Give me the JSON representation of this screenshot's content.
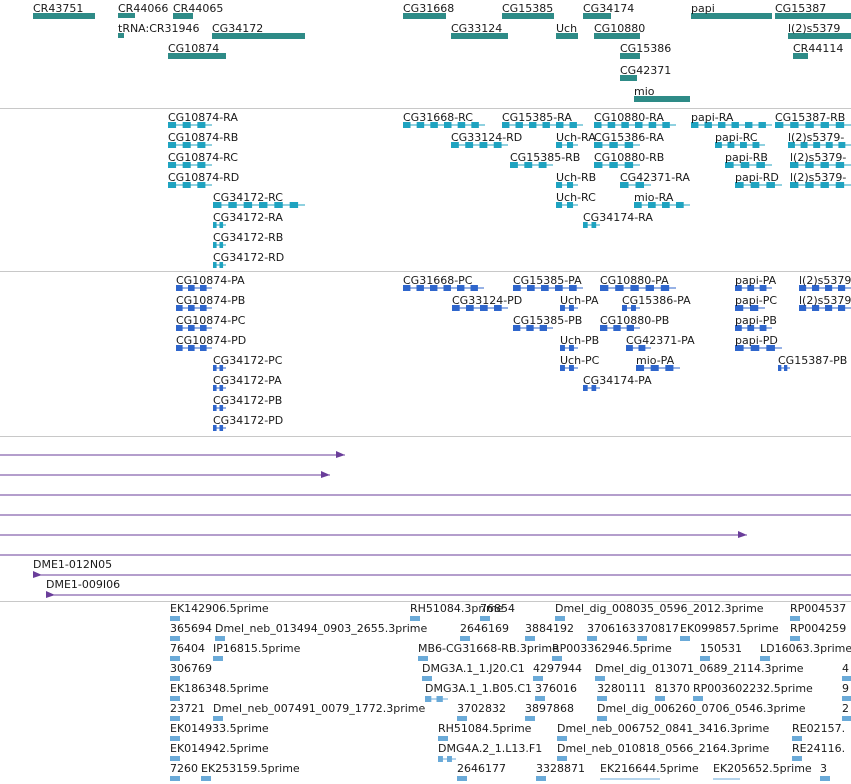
{
  "tracks": [
    {
      "name": "gene-track",
      "color": "#2e8b87",
      "features": [
        {
          "label": "CR43751"
        },
        {
          "label": "CR44066"
        },
        {
          "label": "CR44065"
        },
        {
          "label": "CG31668"
        },
        {
          "label": "CG15385"
        },
        {
          "label": "CG34174"
        },
        {
          "label": "papi"
        },
        {
          "label": "CG15387"
        },
        {
          "label": "tRNA:CR31946"
        },
        {
          "label": "CG34172"
        },
        {
          "label": "CG33124"
        },
        {
          "label": "Uch"
        },
        {
          "label": "CG10880"
        },
        {
          "label": "l(2)s5379"
        },
        {
          "label": "CG10874"
        },
        {
          "label": "CG15386"
        },
        {
          "label": "CR44114"
        },
        {
          "label": "CG42371"
        },
        {
          "label": "mio"
        }
      ]
    },
    {
      "name": "transcript-track",
      "color": "#1fa3c0",
      "features": [
        {
          "label": "CG10874-RA"
        },
        {
          "label": "CG10874-RB"
        },
        {
          "label": "CG10874-RC"
        },
        {
          "label": "CG10874-RD"
        },
        {
          "label": "CG34172-RC"
        },
        {
          "label": "CG34172-RA"
        },
        {
          "label": "CG34172-RB"
        },
        {
          "label": "CG34172-RD"
        },
        {
          "label": "CG31668-RC"
        },
        {
          "label": "CG33124-RD"
        },
        {
          "label": "CG15385-RA"
        },
        {
          "label": "Uch-RA"
        },
        {
          "label": "CG15385-RB"
        },
        {
          "label": "Uch-RB"
        },
        {
          "label": "Uch-RC"
        },
        {
          "label": "CG10880-RA"
        },
        {
          "label": "CG15386-RA"
        },
        {
          "label": "CG10880-RB"
        },
        {
          "label": "CG42371-RA"
        },
        {
          "label": "mio-RA"
        },
        {
          "label": "CG34174-RA"
        },
        {
          "label": "papi-RA"
        },
        {
          "label": "papi-RC"
        },
        {
          "label": "papi-RB"
        },
        {
          "label": "papi-RD"
        },
        {
          "label": "CG15387-RB"
        },
        {
          "label": "l(2)s5379-"
        },
        {
          "label": "l(2)s5379-"
        },
        {
          "label": "l(2)s5379-"
        }
      ]
    },
    {
      "name": "protein-track",
      "color": "#2f66cc",
      "features": [
        {
          "label": "CG10874-PA"
        },
        {
          "label": "CG10874-PB"
        },
        {
          "label": "CG10874-PC"
        },
        {
          "label": "CG10874-PD"
        },
        {
          "label": "CG34172-PC"
        },
        {
          "label": "CG34172-PA"
        },
        {
          "label": "CG34172-PB"
        },
        {
          "label": "CG34172-PD"
        },
        {
          "label": "CG31668-PC"
        },
        {
          "label": "CG33124-PD"
        },
        {
          "label": "CG15385-PA"
        },
        {
          "label": "Uch-PA"
        },
        {
          "label": "CG15385-PB"
        },
        {
          "label": "Uch-PB"
        },
        {
          "label": "Uch-PC"
        },
        {
          "label": "CG10880-PA"
        },
        {
          "label": "CG15386-PA"
        },
        {
          "label": "CG10880-PB"
        },
        {
          "label": "CG42371-PA"
        },
        {
          "label": "mio-PA"
        },
        {
          "label": "CG34174-PA"
        },
        {
          "label": "papi-PA"
        },
        {
          "label": "papi-PC"
        },
        {
          "label": "papi-PB"
        },
        {
          "label": "papi-PD"
        },
        {
          "label": "l(2)s5379"
        },
        {
          "label": "l(2)s5379"
        },
        {
          "label": "CG15387-PB"
        }
      ]
    },
    {
      "name": "clone-track",
      "color": "#6a3d9a",
      "features": [
        {
          "label": ""
        },
        {
          "label": ""
        },
        {
          "label": ""
        },
        {
          "label": ""
        },
        {
          "label": ""
        },
        {
          "label": ""
        },
        {
          "label": "DME1-012N05"
        },
        {
          "label": "DME1-009I06"
        }
      ]
    },
    {
      "name": "est-track",
      "color": "#6aaad8",
      "features": [
        {
          "label": "EK142906.5prime"
        },
        {
          "label": "RH51084.3prime"
        },
        {
          "label": "76854"
        },
        {
          "label": "Dmel_dig_008035_0596_2012.3prime"
        },
        {
          "label": "RP004537"
        },
        {
          "label": "365694"
        },
        {
          "label": "Dmel_neb_013494_0903_2655.3prime"
        },
        {
          "label": "2646169"
        },
        {
          "label": "3884192"
        },
        {
          "label": "3706163"
        },
        {
          "label": "370817"
        },
        {
          "label": "EK099857.5prime"
        },
        {
          "label": "RP004259"
        },
        {
          "label": "76404"
        },
        {
          "label": "IP16815.5prime"
        },
        {
          "label": "MB6-CG31668-RB.3prime"
        },
        {
          "label": "RP003362946.5prime"
        },
        {
          "label": "150531"
        },
        {
          "label": "LD16063.3prime"
        },
        {
          "label": "306769"
        },
        {
          "label": "DMG3A.1_1.J20.C1"
        },
        {
          "label": "4297944"
        },
        {
          "label": "Dmel_dig_013071_0689_2114.3prime"
        },
        {
          "label": "4"
        },
        {
          "label": "EK186348.5prime"
        },
        {
          "label": "DMG3A.1_1.B05.C1"
        },
        {
          "label": "376016"
        },
        {
          "label": "3280111"
        },
        {
          "label": "81370"
        },
        {
          "label": "RP003602232.5prime"
        },
        {
          "label": "9"
        },
        {
          "label": "23721"
        },
        {
          "label": "Dmel_neb_007491_0079_1772.3prime"
        },
        {
          "label": "3702832"
        },
        {
          "label": "3897868"
        },
        {
          "label": "Dmel_dig_006260_0706_0546.3prime"
        },
        {
          "label": "2"
        },
        {
          "label": "EK014933.5prime"
        },
        {
          "label": "RH51084.5prime"
        },
        {
          "label": "Dmel_neb_006752_0841_3416.3prime"
        },
        {
          "label": "RE02157."
        },
        {
          "label": "EK014942.5prime"
        },
        {
          "label": "DMG4A.2_1.L13.F1"
        },
        {
          "label": "Dmel_neb_010818_0566_2164.3prime"
        },
        {
          "label": "RE24116."
        },
        {
          "label": "7260"
        },
        {
          "label": "EK253159.5prime"
        },
        {
          "label": "2646177"
        },
        {
          "label": "3328871"
        },
        {
          "label": "EK216644.5prime"
        },
        {
          "label": "EK205652.5prime"
        },
        {
          "label": "3"
        }
      ]
    }
  ]
}
